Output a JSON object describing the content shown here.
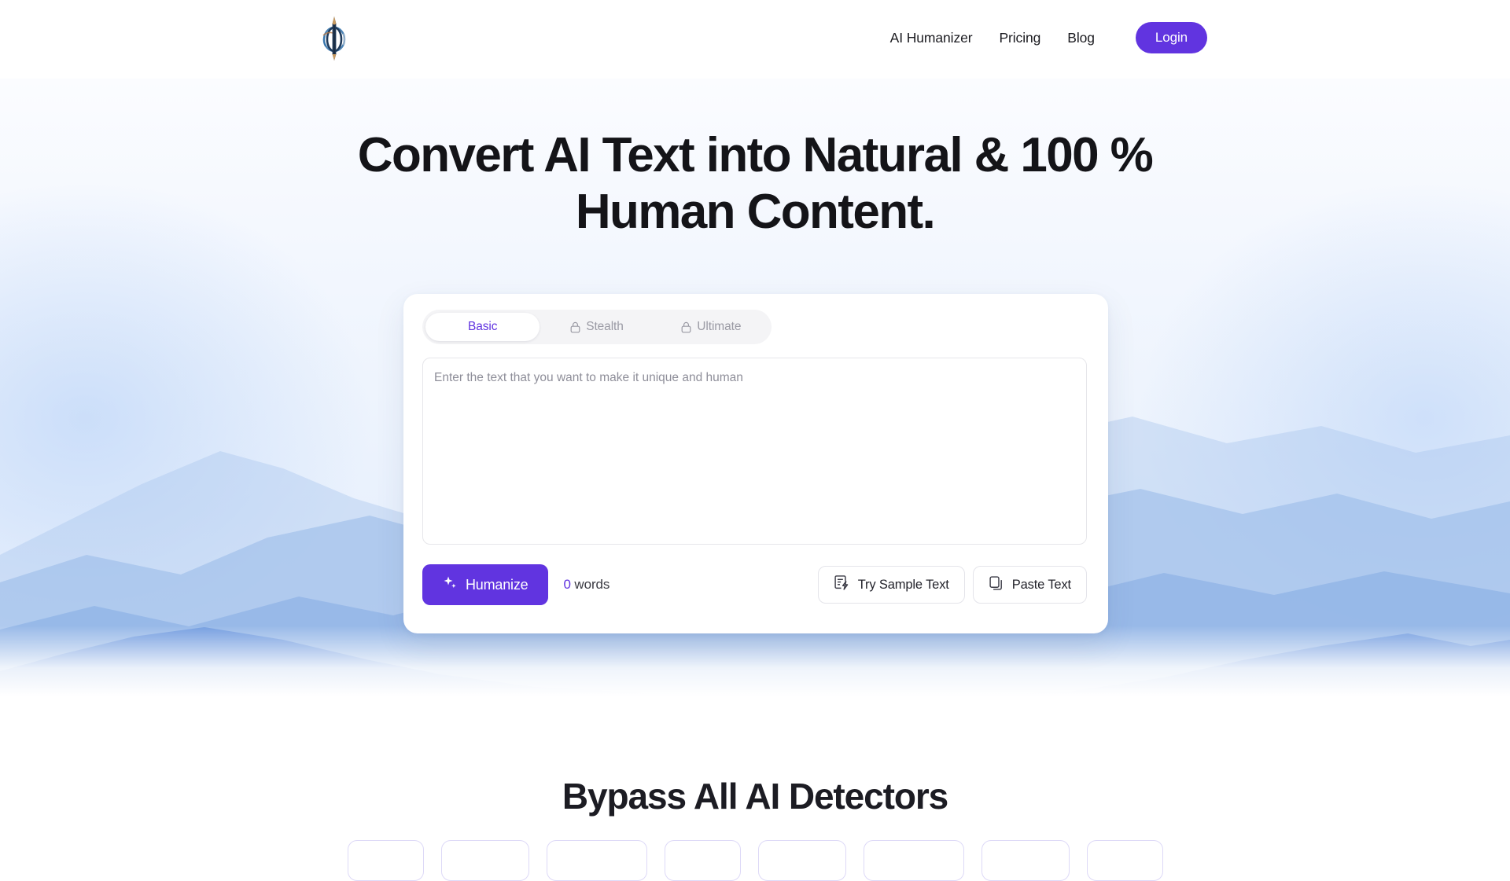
{
  "brand": {
    "logo_icon": "obelisk-pen-logo-icon"
  },
  "header": {
    "nav": [
      {
        "label": "AI Humanizer"
      },
      {
        "label": "Pricing"
      },
      {
        "label": "Blog"
      }
    ],
    "login_label": "Login",
    "login_color": "#6134e0"
  },
  "hero": {
    "title_line1": "Convert AI Text into Natural & 100 %",
    "title_line2": "Human Content."
  },
  "humanizer": {
    "tabs": [
      {
        "label": "Basic",
        "locked": false,
        "active": true
      },
      {
        "label": "Stealth",
        "locked": true,
        "active": false
      },
      {
        "label": "Ultimate",
        "locked": true,
        "active": false
      }
    ],
    "editor_placeholder": "Enter the text that you want to make it unique and human",
    "editor_value": "",
    "humanize_label": "Humanize",
    "humanize_icon": "sparkle-icon",
    "word_count_number": "0",
    "word_count_label": "words",
    "try_sample_label": "Try Sample Text",
    "try_sample_icon": "sample-text-icon",
    "paste_label": "Paste Text",
    "paste_icon": "copy-icon",
    "accent_color": "#6134e0"
  },
  "detectors_section": {
    "title": "Bypass All AI Detectors",
    "pills": [
      {
        "width": "w1"
      },
      {
        "width": "w2"
      },
      {
        "width": "w3"
      },
      {
        "width": "w1"
      },
      {
        "width": "w2"
      },
      {
        "width": "w3"
      },
      {
        "width": "w2"
      },
      {
        "width": "w1"
      }
    ]
  }
}
